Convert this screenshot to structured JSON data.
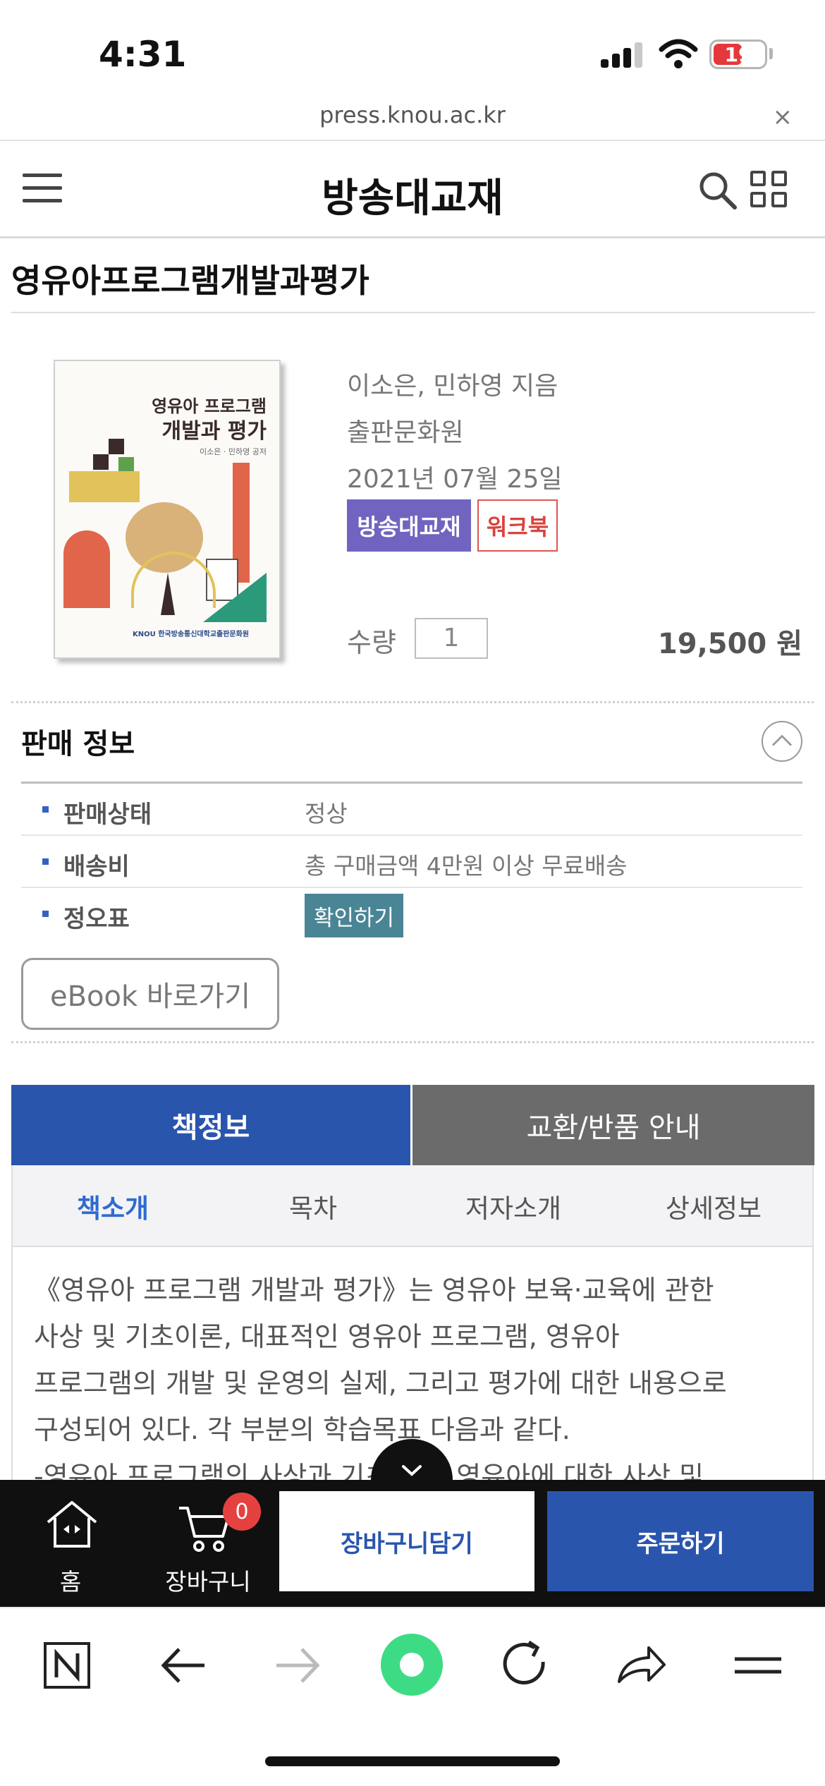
{
  "status_bar": {
    "time": "4:31",
    "battery": "19",
    "battery_level": 0.19
  },
  "browser": {
    "url": "press.knou.ac.kr",
    "close_glyph": "×"
  },
  "header": {
    "title": "방송대교재",
    "menu_icon": "hamburger-icon",
    "search_icon": "search-icon",
    "grid_icon": "grid-icon"
  },
  "product": {
    "title": "영유아프로그램개발과평가",
    "cover": {
      "title_line1": "영유아 프로그램",
      "title_line2": "개발과 평가",
      "authors": "이소은 · 민하영 공저",
      "publisher": "KNOU 한국방송통신대학교출판문화원"
    },
    "authors": "이소은, 민하영 지음",
    "publisher": "출판문화원",
    "date": "2021년 07월 25일",
    "tags": [
      "방송대교재",
      "워크북"
    ],
    "quantity_label": "수량",
    "quantity": "1",
    "price": "19,500 원"
  },
  "sales_info": {
    "title": "판매 정보",
    "rows": [
      {
        "label": "판매상태",
        "value": "정상"
      },
      {
        "label": "배송비",
        "value": "총 구매금액 4만원 이상 무료배송"
      },
      {
        "label": "정오표",
        "value": "확인하기"
      }
    ],
    "ebook_button": "eBook 바로가기"
  },
  "tabs": {
    "main": [
      "책정보",
      "교환/반품 안내"
    ],
    "sub": [
      "책소개",
      "목차",
      "저자소개",
      "상세정보"
    ]
  },
  "description": {
    "text": "《영유아 프로그램 개발과 평가》는 영유아 보육·교육에 관한\n사상 및 기초이론, 대표적인 영유아 프로그램, 영유아\n프로그램의 개발 및 운영의 실제, 그리고 평가에 대한 내용으로\n구성되어 있다. 각 부분의 학습목표 다음과 같다.\n-영유아 프로그램의 사상과 기초이론: 영유아에 대한 사상 및"
  },
  "action_bar": {
    "home_label": "홈",
    "cart_label": "장바구니",
    "cart_count": "0",
    "add_to_cart": "장바구니담기",
    "order": "주문하기"
  },
  "colors": {
    "primary": "#2955ad",
    "tag_purple": "#7064c0",
    "tag_red": "#d9433d",
    "confirm": "#4a8596"
  }
}
